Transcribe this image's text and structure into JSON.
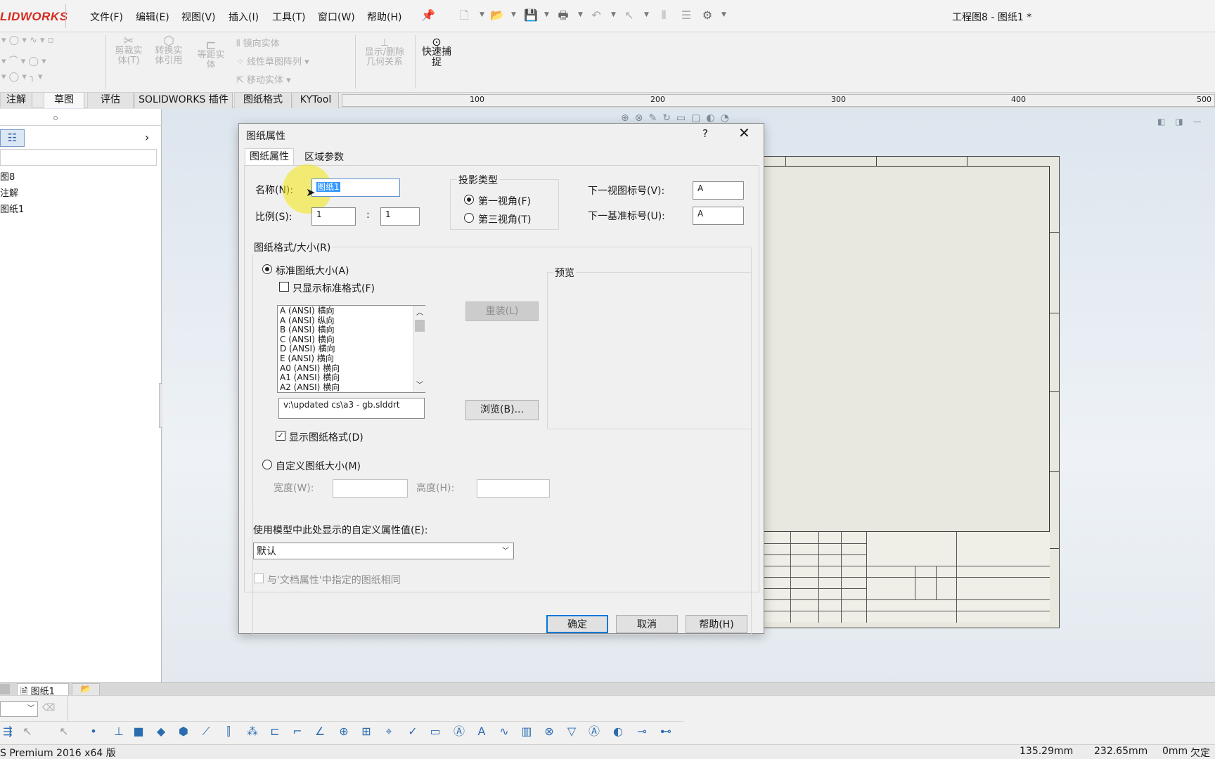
{
  "app": {
    "logo": "LIDWORKS",
    "window_title": "工程图8 - 图纸1 *"
  },
  "menu": [
    {
      "label": "文件(F)"
    },
    {
      "label": "编辑(E)"
    },
    {
      "label": "视图(V)"
    },
    {
      "label": "插入(I)"
    },
    {
      "label": "工具(T)"
    },
    {
      "label": "窗口(W)"
    },
    {
      "label": "帮助(H)"
    }
  ],
  "ribbon": {
    "trim": "剪裁实\n体(T)",
    "convert": "转换实\n体引用",
    "offset": "等距实\n体",
    "mirror": "镜向实体",
    "linear_pattern": "线性草图阵列",
    "move": "移动实体",
    "relations": "显示/删除\n几何关系",
    "quick_snap": "快速捕\n捉"
  },
  "tabs": [
    {
      "label": "注解"
    },
    {
      "label": "草图"
    },
    {
      "label": "评估"
    },
    {
      "label": "SOLIDWORKS 插件"
    },
    {
      "label": "图纸格式"
    },
    {
      "label": "KYTool"
    }
  ],
  "ruler": [
    "100",
    "200",
    "300",
    "400",
    "500"
  ],
  "tree": {
    "items": [
      "图8",
      "注解",
      "图纸1"
    ]
  },
  "dialog": {
    "title": "图纸属性",
    "help_icon": "?",
    "tabs": [
      "图纸属性",
      "区域参数"
    ],
    "name_label": "名称(N):",
    "name_value": "图纸1",
    "scale_label": "比例(S):",
    "scale_num": "1",
    "scale_sep": ":",
    "scale_den": "1",
    "projection": {
      "title": "投影类型",
      "first": "第一视角(F)",
      "third": "第三视角(T)",
      "selected": "first"
    },
    "next_view_label": "下一视图标号(V):",
    "next_view_value": "A",
    "next_datum_label": "下一基准标号(U):",
    "next_datum_value": "A",
    "format_group": "图纸格式/大小(R)",
    "standard_size": "标准图纸大小(A)",
    "only_standard": "只显示标准格式(F)",
    "sizes": [
      "A (ANSI) 横向",
      "A (ANSI) 纵向",
      "B (ANSI) 横向",
      "C (ANSI) 横向",
      "D (ANSI) 横向",
      "E (ANSI) 横向",
      "A0 (ANSI) 横向",
      "A1 (ANSI) 横向",
      "A2 (ANSI) 横向"
    ],
    "reload": "重装(L)",
    "format_path": "v:\\updated cs\\a3 - gb.slddrt",
    "browse": "浏览(B)...",
    "show_format": "显示图纸格式(D)",
    "preview": "预览",
    "custom_size": "自定义图纸大小(M)",
    "width_label": "宽度(W):",
    "height_label": "高度(H):",
    "custom_prop_label": "使用模型中此处显示的自定义属性值(E):",
    "custom_prop_value": "默认",
    "same_as_doc": "与'文档属性'中指定的图纸相同",
    "ok": "确定",
    "cancel": "取消",
    "help": "帮助(H)"
  },
  "sheet_tabs": {
    "active": "图纸1"
  },
  "status": {
    "product": "S Premium 2016 x64 版",
    "x": "135.29mm",
    "y": "232.65mm",
    "z": "0mm",
    "state": "欠定"
  },
  "colors": {
    "accent": "#0078d7",
    "logo": "#d52b1e",
    "highlight": "#f2e70d"
  }
}
